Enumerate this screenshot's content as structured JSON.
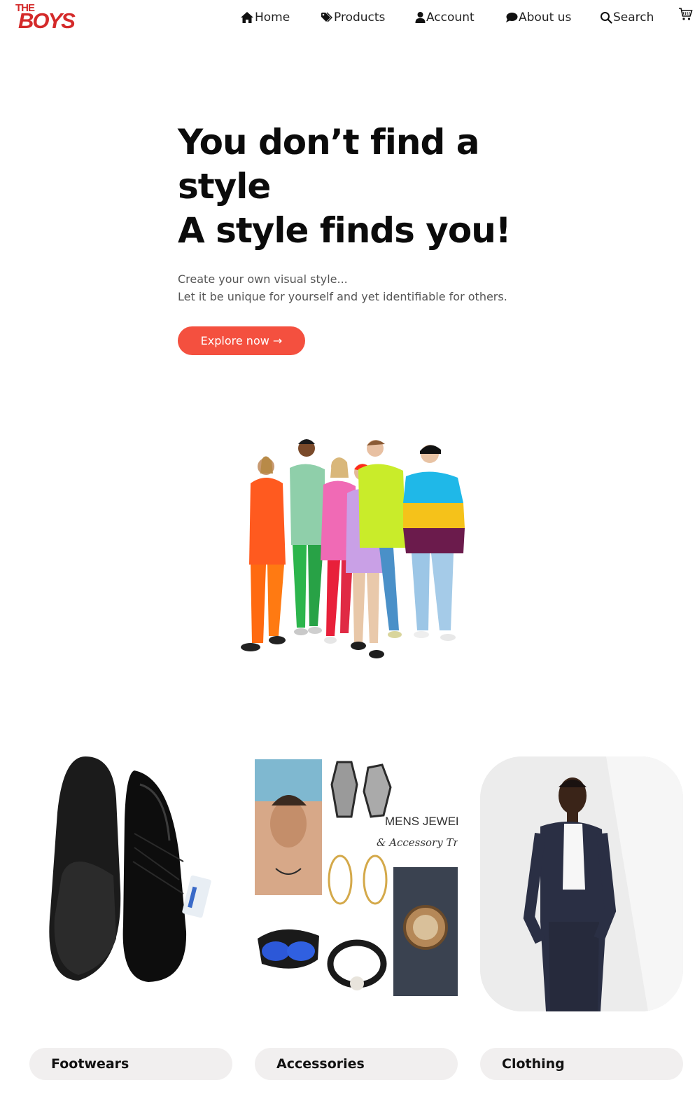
{
  "brand": {
    "logo_top": "THE",
    "logo_main": "BOYS"
  },
  "nav": {
    "home": "Home",
    "products": "Products",
    "account": "Account",
    "about": "About us",
    "search": "Search"
  },
  "icons": {
    "home": "home-icon",
    "products": "tag-icon",
    "account": "user-icon",
    "about": "chat-icon",
    "search": "search-icon",
    "cart": "cart-icon"
  },
  "hero": {
    "title_line1": "You don’t find a",
    "title_line2": "style",
    "title_line3": "A style finds you!",
    "subtitle_line1": "Create your own visual style...",
    "subtitle_line2": "Let it be unique for yourself and yet identifiable for others.",
    "cta": "Explore now →"
  },
  "accessories_image": {
    "title": "MENS JEWELRY",
    "subtitle": "& Accessory Trends"
  },
  "categories": [
    {
      "label": "Footwears"
    },
    {
      "label": "Accessories"
    },
    {
      "label": "Clothing"
    }
  ],
  "colors": {
    "accent": "#f4503f",
    "logo": "#d42a2a",
    "label_bg": "#f1efef"
  }
}
